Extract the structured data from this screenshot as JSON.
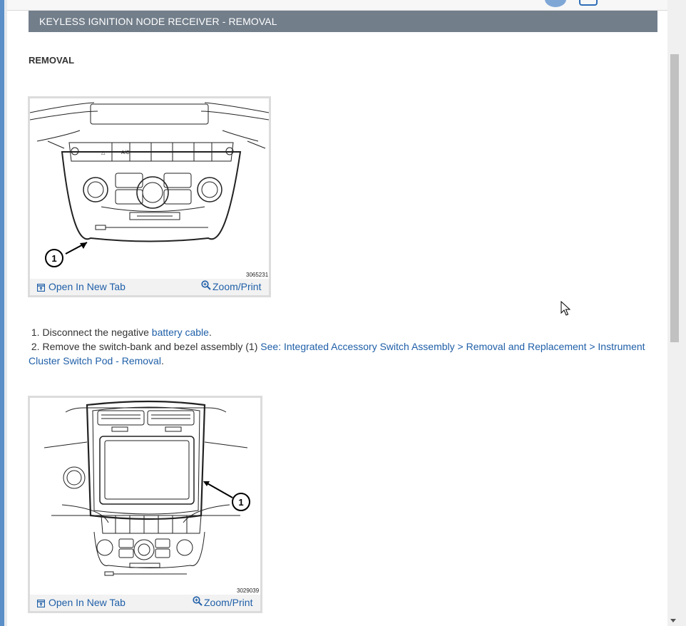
{
  "header": {
    "title": "KEYLESS IGNITION NODE RECEIVER - REMOVAL"
  },
  "section": {
    "title": "REMOVAL"
  },
  "figures": [
    {
      "id": "3065231",
      "callout": "1",
      "open_label": "Open In New Tab",
      "zoom_label": "Zoom/Print"
    },
    {
      "id": "3029039",
      "callout": "1",
      "open_label": "Open In New Tab",
      "zoom_label": "Zoom/Print"
    }
  ],
  "steps": [
    {
      "number": "1.",
      "text": "Disconnect the negative",
      "link": "battery cable",
      "suffix": "."
    },
    {
      "number": "2.",
      "text": "Remove the switch-bank and bezel assembly (1)",
      "link": "See: Integrated Accessory Switch Assembly > Removal and Replacement > Instrument Cluster Switch Pod - Removal",
      "suffix": "."
    }
  ],
  "icons": {
    "open_tab": "open-in-new-tab-icon",
    "zoom": "magnifier-icon",
    "cursor": "mouse-pointer-icon"
  },
  "colors": {
    "header_bg": "#727e8a",
    "link": "#1f5fa8"
  }
}
